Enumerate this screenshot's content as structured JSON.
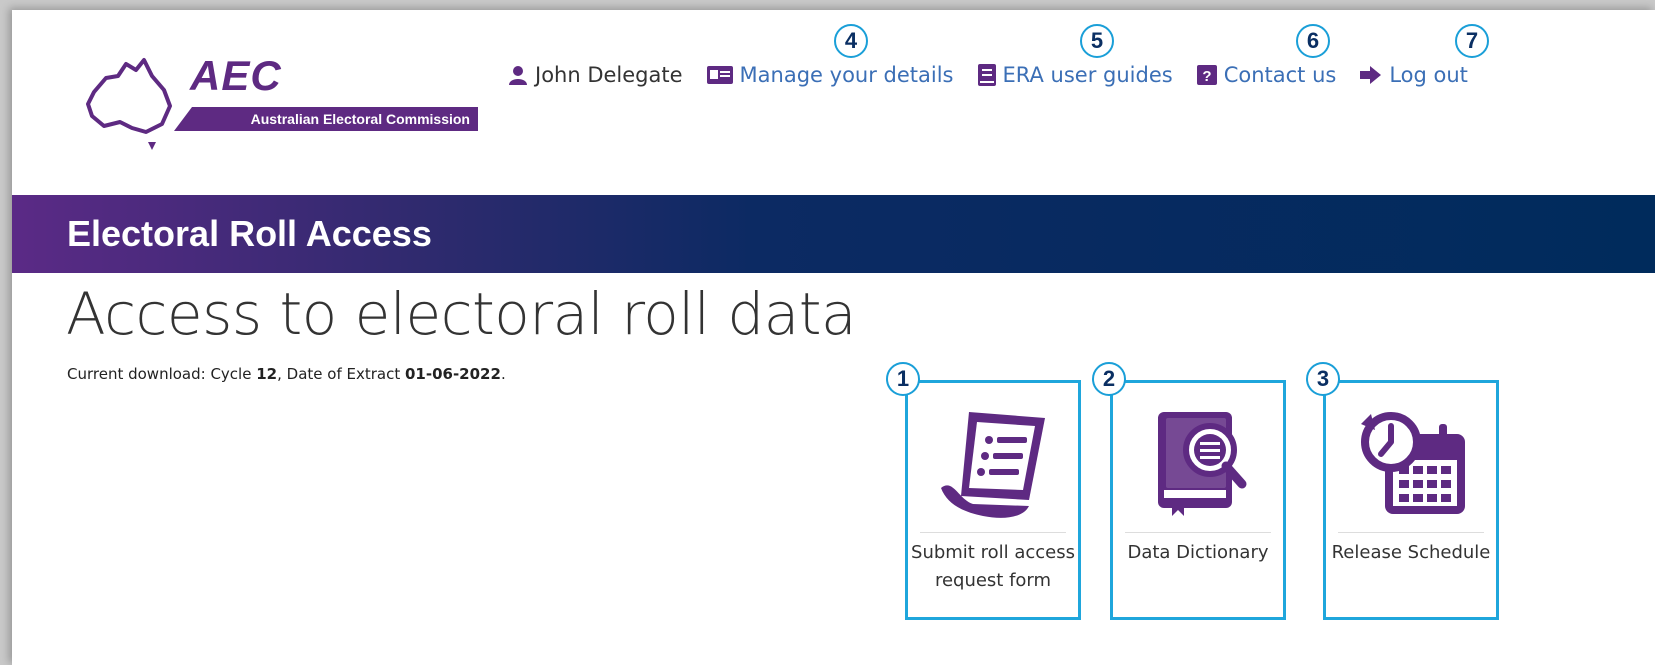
{
  "logo": {
    "name": "AEC",
    "subtitle": "Australian Electoral Commission"
  },
  "nav": {
    "user": "John Delegate",
    "items": [
      {
        "label": "Manage your details",
        "callout": "4"
      },
      {
        "label": "ERA user guides",
        "callout": "5"
      },
      {
        "label": "Contact us",
        "callout": "6"
      },
      {
        "label": "Log out",
        "callout": "7"
      }
    ]
  },
  "banner": {
    "title": "Electoral Roll Access"
  },
  "page": {
    "title": "Access to electoral roll data",
    "download_prefix": "Current download: Cycle ",
    "cycle": "12",
    "extract_prefix": ", Date of Extract ",
    "extract_date": "01-06-2022",
    "suffix": "."
  },
  "tiles": [
    {
      "label": "Submit roll access request form",
      "callout": "1",
      "icon": "document-list-icon"
    },
    {
      "label": "Data Dictionary",
      "callout": "2",
      "icon": "book-magnifier-icon"
    },
    {
      "label": "Release Schedule",
      "callout": "3",
      "icon": "calendar-clock-icon"
    }
  ],
  "colors": {
    "brand_purple": "#5e2a82",
    "link": "#3b6fb6",
    "callout_border": "#1a9fd8",
    "banner_navy": "#002b5c"
  }
}
